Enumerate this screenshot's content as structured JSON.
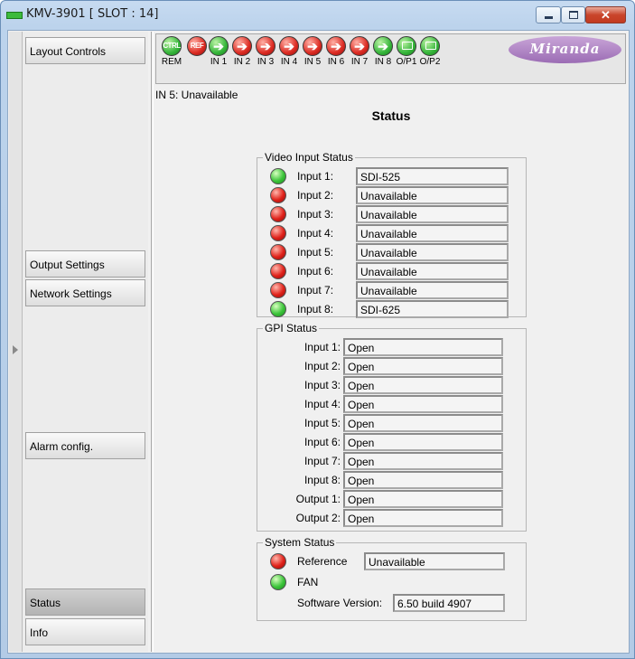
{
  "window": {
    "title": "KMV-3901 [ SLOT : 14]",
    "close_symbol": "✕"
  },
  "sidebar": {
    "items": [
      {
        "label": "Layout Controls"
      },
      {
        "label": "Output Settings"
      },
      {
        "label": "Network Settings"
      },
      {
        "label": "Alarm config."
      },
      {
        "label": "Status"
      },
      {
        "label": "Info"
      }
    ]
  },
  "toolbar": {
    "indicators": [
      {
        "text": "CTRL",
        "label": "REM",
        "color": "green",
        "icon": "ctrl-icon"
      },
      {
        "text": "REF",
        "label": "",
        "color": "red",
        "icon": "ref-icon"
      },
      {
        "label": "IN 1",
        "color": "green",
        "icon": "arrow-right-icon"
      },
      {
        "label": "IN 2",
        "color": "red",
        "icon": "arrow-right-icon"
      },
      {
        "label": "IN 3",
        "color": "red",
        "icon": "arrow-right-icon"
      },
      {
        "label": "IN 4",
        "color": "red",
        "icon": "arrow-right-icon"
      },
      {
        "label": "IN 5",
        "color": "red",
        "icon": "arrow-right-icon"
      },
      {
        "label": "IN 6",
        "color": "red",
        "icon": "arrow-right-icon"
      },
      {
        "label": "IN 7",
        "color": "red",
        "icon": "arrow-right-icon"
      },
      {
        "label": "IN 8",
        "color": "green",
        "icon": "arrow-right-icon"
      },
      {
        "label": "O/P1",
        "color": "green",
        "icon": "monitor-icon"
      },
      {
        "label": "O/P2",
        "color": "green",
        "icon": "monitor-icon"
      }
    ],
    "logo": "Miranda"
  },
  "status_line": "IN 5: Unavailable",
  "main": {
    "title": "Status",
    "video_input": {
      "title": "Video Input Status",
      "rows": [
        {
          "label": "Input 1:",
          "value": "SDI-525",
          "state": "green"
        },
        {
          "label": "Input 2:",
          "value": "Unavailable",
          "state": "red"
        },
        {
          "label": "Input 3:",
          "value": "Unavailable",
          "state": "red"
        },
        {
          "label": "Input 4:",
          "value": "Unavailable",
          "state": "red"
        },
        {
          "label": "Input 5:",
          "value": "Unavailable",
          "state": "red"
        },
        {
          "label": "Input 6:",
          "value": "Unavailable",
          "state": "red"
        },
        {
          "label": "Input 7:",
          "value": "Unavailable",
          "state": "red"
        },
        {
          "label": "Input 8:",
          "value": "SDI-625",
          "state": "green"
        }
      ]
    },
    "gpi": {
      "title": "GPI Status",
      "rows": [
        {
          "label": "Input 1:",
          "value": "Open"
        },
        {
          "label": "Input 2:",
          "value": "Open"
        },
        {
          "label": "Input 3:",
          "value": "Open"
        },
        {
          "label": "Input 4:",
          "value": "Open"
        },
        {
          "label": "Input 5:",
          "value": "Open"
        },
        {
          "label": "Input 6:",
          "value": "Open"
        },
        {
          "label": "Input 7:",
          "value": "Open"
        },
        {
          "label": "Input 8:",
          "value": "Open"
        },
        {
          "label": "Output 1:",
          "value": "Open"
        },
        {
          "label": "Output 2:",
          "value": "Open"
        }
      ]
    },
    "system": {
      "title": "System Status",
      "reference_label": "Reference",
      "reference_value": "Unavailable",
      "reference_state": "red",
      "fan_label": "FAN",
      "fan_state": "green",
      "software_label": "Software Version:",
      "software_value": "6.50 build 4907"
    }
  },
  "colors": {
    "ok": "#35b53a",
    "error": "#dc2b22",
    "brand": "#9b6cb4"
  }
}
